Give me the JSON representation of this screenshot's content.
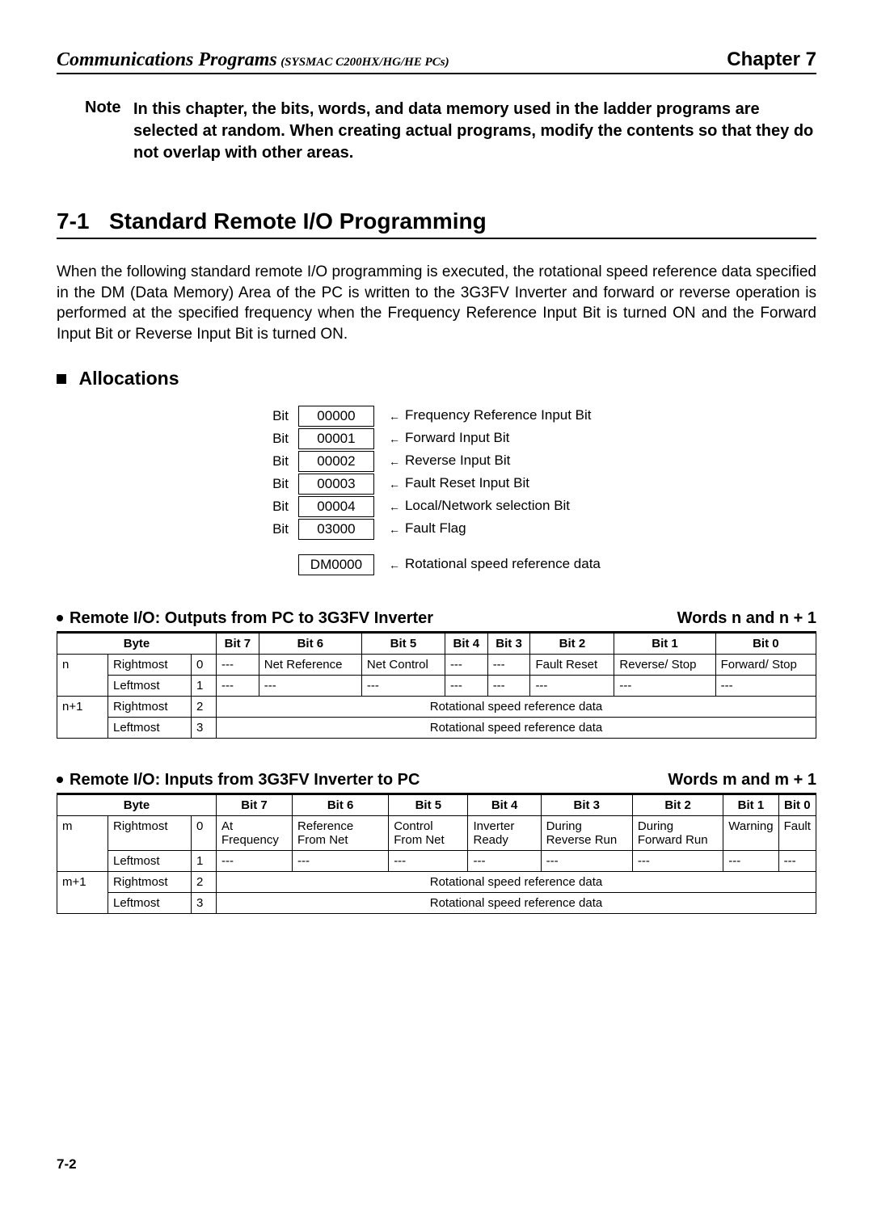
{
  "header": {
    "title": "Communications Programs",
    "subtitle": "(SYSMAC C200HX/HG/HE PCs)",
    "chapter": "Chapter 7"
  },
  "note": {
    "label": "Note",
    "text": "In this chapter, the bits, words, and data memory used in the ladder programs are selected at random. When creating actual programs, modify the contents so that they do not overlap with other areas."
  },
  "section": {
    "num": "7-1",
    "title": "Standard Remote I/O Programming"
  },
  "intro": "When the following standard remote I/O programming is executed, the rotational speed reference data specified in the DM (Data Memory) Area of the PC is written to the 3G3FV Inverter and forward or reverse operation is performed at the specified frequency when the Frequency Reference Input Bit is turned ON and the Forward Input Bit or Reverse Input Bit is turned ON.",
  "allocations": {
    "heading": "Allocations",
    "rows": [
      {
        "label": "Bit",
        "code": "00000",
        "desc": "Frequency Reference Input Bit"
      },
      {
        "label": "Bit",
        "code": "00001",
        "desc": "Forward Input Bit"
      },
      {
        "label": "Bit",
        "code": "00002",
        "desc": "Reverse Input Bit"
      },
      {
        "label": "Bit",
        "code": "00003",
        "desc": "Fault Reset Input Bit"
      },
      {
        "label": "Bit",
        "code": "00004",
        "desc": "Local/Network selection Bit"
      },
      {
        "label": "Bit",
        "code": "03000",
        "desc": "Fault Flag"
      }
    ],
    "dm": {
      "code": "DM0000",
      "desc": "Rotational speed reference data"
    }
  },
  "outputs": {
    "title": "Remote I/O: Outputs from PC to 3G3FV Inverter",
    "words": "Words n and n + 1",
    "headers": [
      "Byte",
      "",
      "Bit 7",
      "Bit 6",
      "Bit 5",
      "Bit 4",
      "Bit 3",
      "Bit 2",
      "Bit 1",
      "Bit 0"
    ],
    "row_n": {
      "word": "n",
      "byte": "Rightmost",
      "idx": "0",
      "cells": [
        "---",
        "Net Reference",
        "Net Control",
        "---",
        "---",
        "Fault Reset",
        "Reverse/ Stop",
        "Forward/ Stop"
      ]
    },
    "row_n_left": {
      "byte": "Leftmost",
      "idx": "1",
      "cells": [
        "---",
        "---",
        "---",
        "---",
        "---",
        "---",
        "---",
        "---"
      ]
    },
    "row_n1": {
      "word": "n+1",
      "byte": "Rightmost",
      "idx": "2",
      "span": "Rotational speed reference data"
    },
    "row_n1_left": {
      "byte": "Leftmost",
      "idx": "3",
      "span": "Rotational speed reference data"
    }
  },
  "inputs": {
    "title": "Remote I/O: Inputs from 3G3FV Inverter to PC",
    "words": "Words m and m + 1",
    "headers": [
      "Byte",
      "",
      "Bit 7",
      "Bit 6",
      "Bit 5",
      "Bit 4",
      "Bit 3",
      "Bit 2",
      "Bit 1",
      "Bit 0"
    ],
    "row_m": {
      "word": "m",
      "byte": "Rightmost",
      "idx": "0",
      "cells": [
        "At Frequency",
        "Reference From Net",
        "Control From Net",
        "Inverter Ready",
        "During Reverse Run",
        "During Forward Run",
        "Warning",
        "Fault"
      ]
    },
    "row_m_left": {
      "byte": "Leftmost",
      "idx": "1",
      "cells": [
        "---",
        "---",
        "---",
        "---",
        "---",
        "---",
        "---",
        "---"
      ]
    },
    "row_m1": {
      "word": "m+1",
      "byte": "Rightmost",
      "idx": "2",
      "span": "Rotational speed reference data"
    },
    "row_m1_left": {
      "byte": "Leftmost",
      "idx": "3",
      "span": "Rotational speed reference data"
    }
  },
  "page": "7-2"
}
